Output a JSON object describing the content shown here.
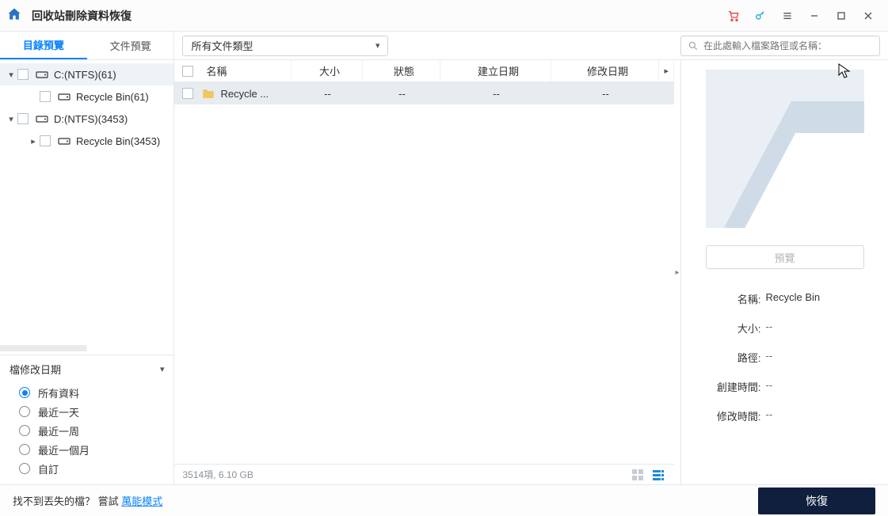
{
  "titlebar": {
    "title": "回收站刪除資料恢復"
  },
  "sidebar": {
    "tabs": {
      "directory": "目錄預覽",
      "files": "文件預覽"
    },
    "tree": {
      "c_drive": "C:(NTFS)(61)",
      "c_recycle": "Recycle Bin(61)",
      "d_drive": "D:(NTFS)(3453)",
      "d_recycle": "Recycle Bin(3453)"
    },
    "filter": {
      "header": "檔修改日期",
      "options": {
        "all": "所有資料",
        "day": "最近一天",
        "week": "最近一周",
        "month": "最近一個月",
        "custom": "自訂"
      }
    }
  },
  "center": {
    "filetype_label": "所有文件類型",
    "search_placeholder": "在此處輸入檔案路徑或名稱：",
    "columns": {
      "name": "名稱",
      "size": "大小",
      "status": "狀態",
      "created": "建立日期",
      "modified": "修改日期"
    },
    "rows": [
      {
        "name": "Recycle ...",
        "size": "--",
        "status": "--",
        "created": "--",
        "modified": "--"
      }
    ],
    "status": "3514項, 6.10 GB"
  },
  "preview": {
    "button": "預覽",
    "meta": {
      "name_label": "名稱:",
      "name_value": "Recycle Bin",
      "size_label": "大小:",
      "size_value": "--",
      "path_label": "路徑:",
      "path_value": "--",
      "created_label": "創建時間:",
      "created_value": "--",
      "modified_label": "修改時間:",
      "modified_value": "--"
    }
  },
  "footer": {
    "hint_prefix": "找不到丟失的檔？ 嘗試 ",
    "hint_link": "萬能模式",
    "recover": "恢復"
  }
}
